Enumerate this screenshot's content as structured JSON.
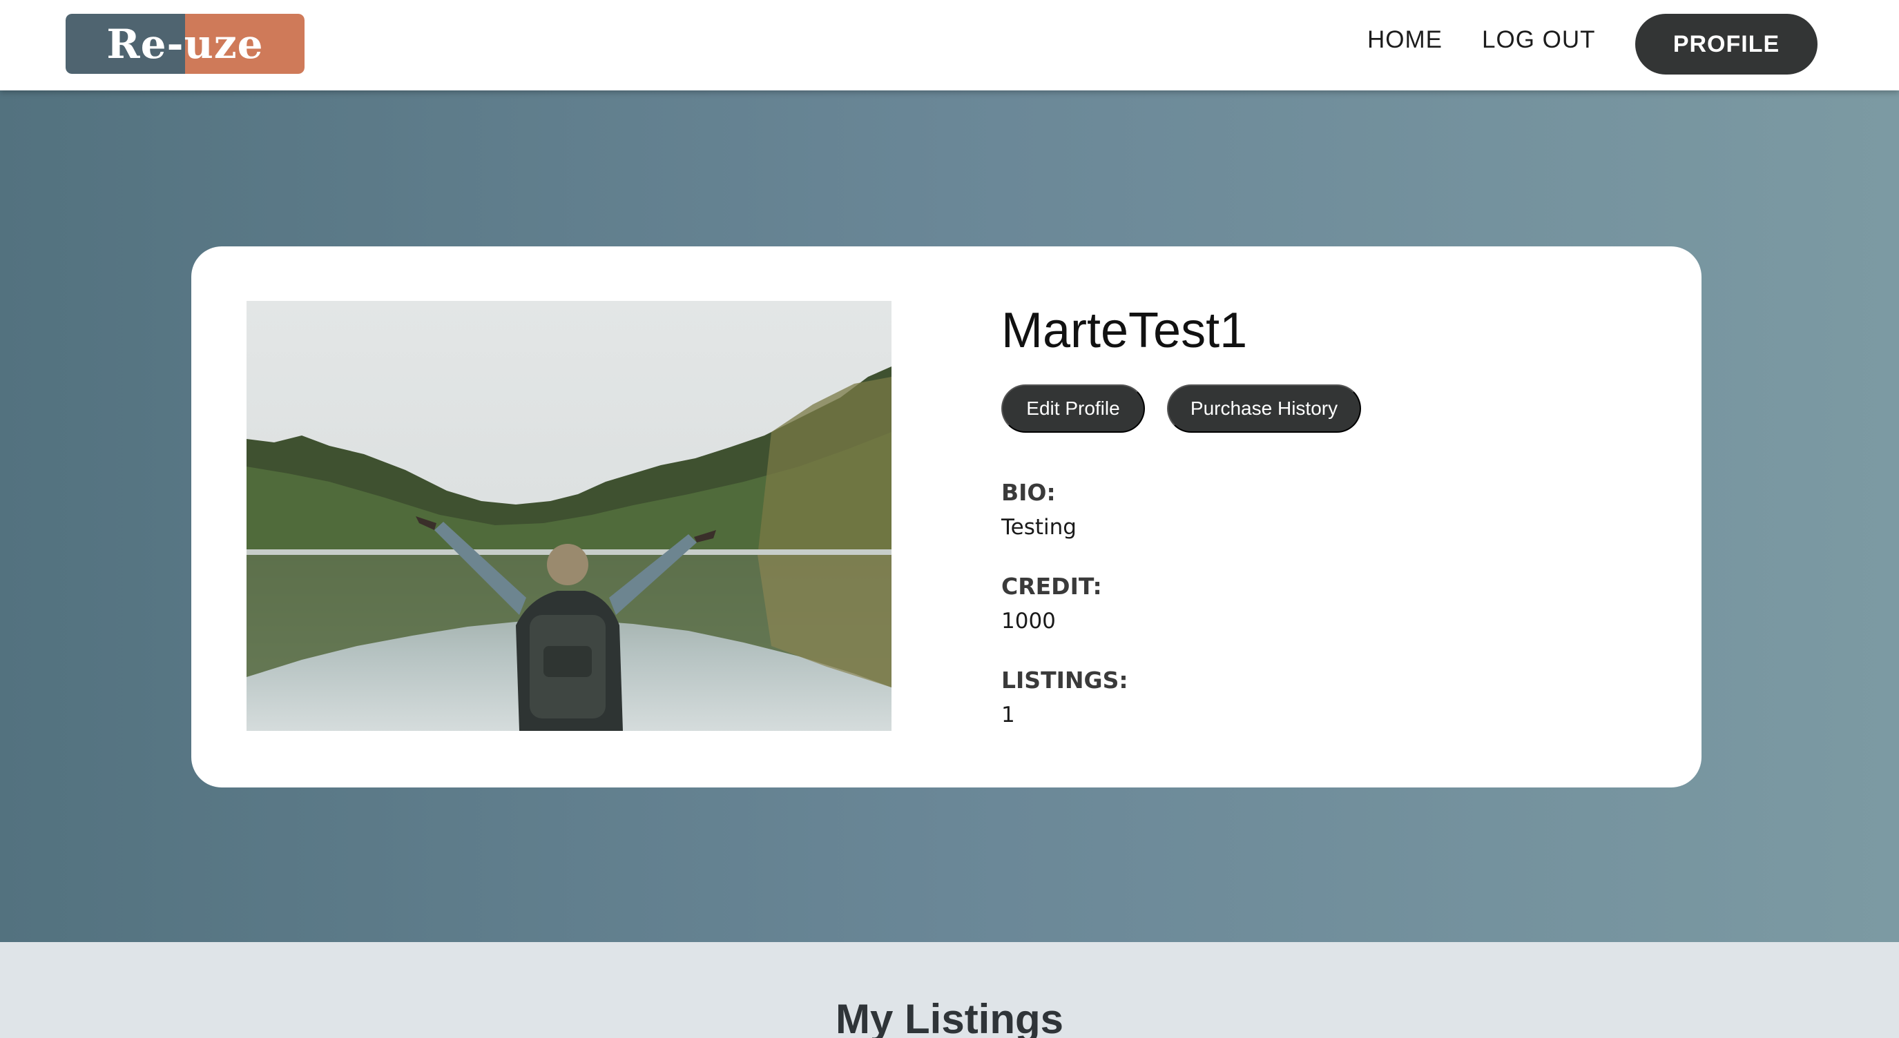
{
  "header": {
    "logo_text": "Re-uze",
    "logo_colors": {
      "left": "#4f6470",
      "right": "#cf7a59"
    },
    "nav": {
      "home": "HOME",
      "logout": "LOG OUT",
      "profile": "PROFILE"
    }
  },
  "profile": {
    "username": "MarteTest1",
    "buttons": {
      "edit": "Edit Profile",
      "history": "Purchase History"
    },
    "bio_label": "BIO:",
    "bio": "Testing",
    "credit_label": "CREDIT:",
    "credit": "1000",
    "listings_label": "LISTINGS:",
    "listings": "1"
  },
  "sections": {
    "my_listings": "My Listings"
  },
  "colors": {
    "dark_button": "#333535",
    "hero_gradient_start": "#53727f",
    "hero_gradient_end": "#7c9aa3",
    "lower_background": "#dfe4e8"
  }
}
